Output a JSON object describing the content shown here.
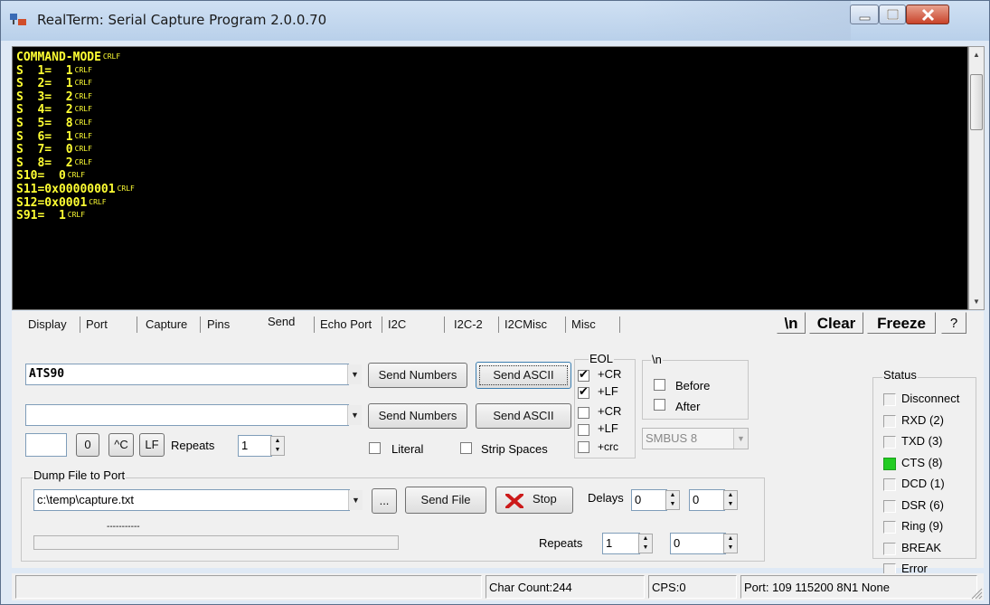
{
  "window": {
    "title": "RealTerm: Serial Capture Program 2.0.0.70"
  },
  "terminal": {
    "lines": [
      {
        "text": "COMMAND-MODE",
        "crlf": "CRLF"
      },
      {
        "text": "S  1=  1",
        "crlf": "CRLF"
      },
      {
        "text": "S  2=  1",
        "crlf": "CRLF"
      },
      {
        "text": "S  3=  2",
        "crlf": "CRLF"
      },
      {
        "text": "S  4=  2",
        "crlf": "CRLF"
      },
      {
        "text": "S  5=  8",
        "crlf": "CRLF"
      },
      {
        "text": "S  6=  1",
        "crlf": "CRLF"
      },
      {
        "text": "S  7=  0",
        "crlf": "CRLF"
      },
      {
        "text": "S  8=  2",
        "crlf": "CRLF"
      },
      {
        "text": "S10=  0",
        "crlf": "CRLF"
      },
      {
        "text": "S11=0x00000001",
        "crlf": "CRLF"
      },
      {
        "text": "S12=0x0001",
        "crlf": "CRLF"
      },
      {
        "text": "S91=  1",
        "crlf": "CRLF"
      }
    ]
  },
  "tabs": [
    "Display",
    "Port",
    "Capture",
    "Pins",
    "Send",
    "Echo Port",
    "I2C",
    "I2C-2",
    "I2CMisc",
    "Misc"
  ],
  "toolbar": {
    "newline_label": "\\n",
    "clear_label": "Clear",
    "freeze_label": "Freeze",
    "help_label": "?"
  },
  "send": {
    "line1_value": "ATS90",
    "line2_value": "",
    "send_numbers_1": "Send Numbers",
    "send_ascii_1": "Send ASCII",
    "send_numbers_2": "Send Numbers",
    "send_ascii_2": "Send ASCII",
    "char_value": "",
    "zero_label": "0",
    "ctrl_c_label": "^C",
    "lf_label": "LF",
    "repeats_label": "Repeats",
    "repeats_value": "1",
    "literal_label": "Literal",
    "strip_spaces_label": "Strip Spaces"
  },
  "eol": {
    "title": "EOL",
    "cr1": "+CR",
    "lf1": "+LF",
    "cr2": "+CR",
    "lf2": "+LF",
    "crc": "+crc"
  },
  "newline_group": {
    "title": "\\n",
    "before": "Before",
    "after": "After",
    "smbus": "SMBUS 8"
  },
  "dump": {
    "title": "Dump File to Port",
    "file_value": "c:\\temp\\capture.txt",
    "browse_label": "...",
    "send_file_label": "Send File",
    "stop_label": "Stop",
    "delays_label": "Delays",
    "delay1": "0",
    "delay2": "0",
    "repeats_label": "Repeats",
    "repeats1": "1",
    "repeats2": "0",
    "progress_text": "-----------"
  },
  "status": {
    "title": "Status",
    "items": [
      "Disconnect",
      "RXD (2)",
      "TXD (3)",
      "CTS (8)",
      "DCD (1)",
      "DSR (6)",
      "Ring (9)",
      "BREAK",
      "Error"
    ],
    "on_color": "#22cc22"
  },
  "statusbar": {
    "char_count": "Char Count:244",
    "cps": "CPS:0",
    "port": "Port: 109 115200 8N1 None"
  }
}
